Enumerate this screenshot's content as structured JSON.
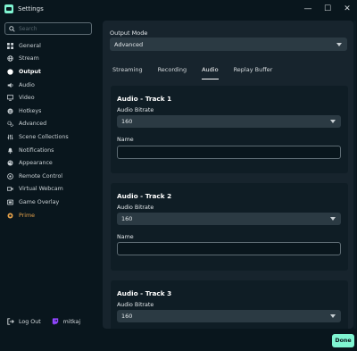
{
  "window": {
    "title": "Settings",
    "controls": {
      "minimize": "—",
      "maximize": "☐",
      "close": "✕"
    }
  },
  "search": {
    "placeholder": "Search"
  },
  "sidebar": {
    "items": [
      {
        "label": "General",
        "icon": "grid-icon"
      },
      {
        "label": "Stream",
        "icon": "globe-icon"
      },
      {
        "label": "Output",
        "icon": "circle-icon",
        "active": true
      },
      {
        "label": "Audio",
        "icon": "speaker-icon"
      },
      {
        "label": "Video",
        "icon": "monitor-icon"
      },
      {
        "label": "Hotkeys",
        "icon": "keyboard-icon"
      },
      {
        "label": "Advanced",
        "icon": "gears-icon"
      },
      {
        "label": "Scene Collections",
        "icon": "sliders-icon"
      },
      {
        "label": "Notifications",
        "icon": "bell-icon"
      },
      {
        "label": "Appearance",
        "icon": "palette-icon"
      },
      {
        "label": "Remote Control",
        "icon": "remote-icon"
      },
      {
        "label": "Virtual Webcam",
        "icon": "camera-icon"
      },
      {
        "label": "Game Overlay",
        "icon": "gamepad-icon"
      },
      {
        "label": "Prime",
        "icon": "prime-icon",
        "color": "#e5a14a"
      }
    ],
    "footer": {
      "logout_label": "Log Out",
      "username": "mitkaj"
    }
  },
  "output": {
    "mode_label": "Output Mode",
    "mode_value": "Advanced",
    "tabs": [
      "Streaming",
      "Recording",
      "Audio",
      "Replay Buffer"
    ],
    "active_tab": "Audio",
    "tracks": [
      {
        "title": "Audio - Track 1",
        "bitrate_label": "Audio Bitrate",
        "bitrate_value": "160",
        "name_label": "Name",
        "name_value": ""
      },
      {
        "title": "Audio - Track 2",
        "bitrate_label": "Audio Bitrate",
        "bitrate_value": "160",
        "name_label": "Name",
        "name_value": ""
      },
      {
        "title": "Audio - Track 3",
        "bitrate_label": "Audio Bitrate",
        "bitrate_value": "160"
      }
    ]
  },
  "done_label": "Done",
  "colors": {
    "background": "#09161d",
    "panel": "#17242d",
    "card": "#0f1d25",
    "select": "#2b3a43",
    "accent": "#80f5d2",
    "prime": "#e5a14a"
  }
}
